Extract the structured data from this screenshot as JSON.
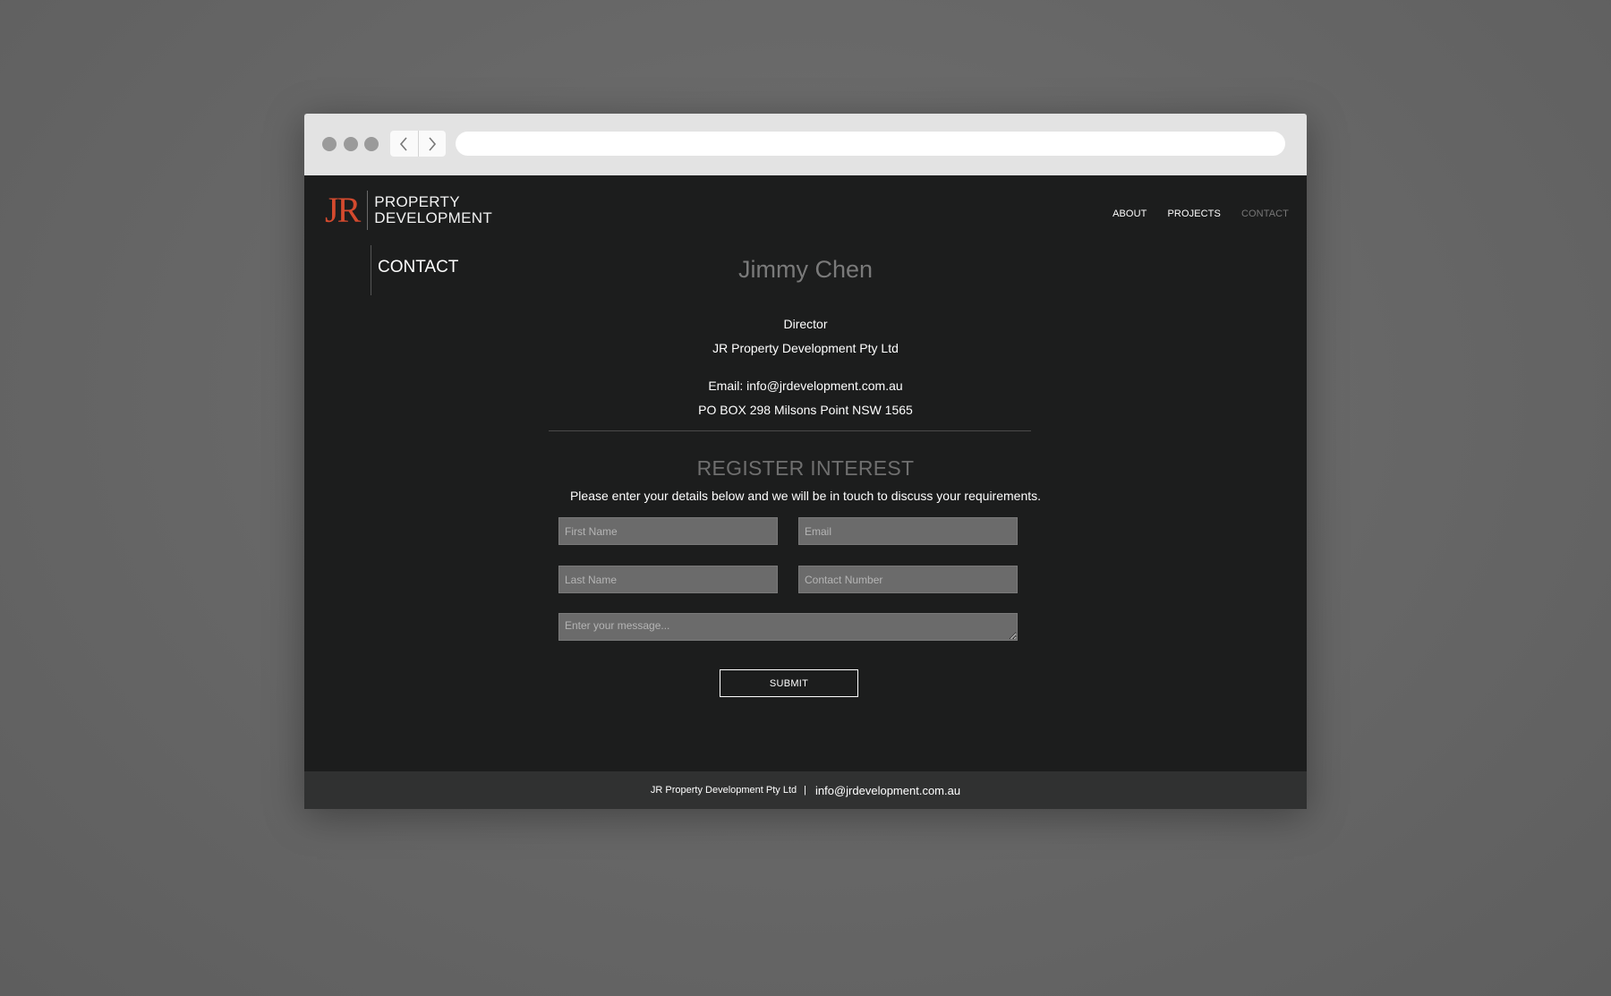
{
  "logo": {
    "mark": "JR",
    "line1": "PROPERTY",
    "line2": "DEVELOPMENT"
  },
  "nav": {
    "about": "ABOUT",
    "projects": "PROJECTS",
    "contact": "CONTACT"
  },
  "sidebar": {
    "title": "CONTACT"
  },
  "contact": {
    "name": "Jimmy Chen",
    "role": "Director",
    "company": "JR Property Development Pty Ltd",
    "email": "Email: info@jrdevelopment.com.au",
    "address": "PO BOX 298 Milsons Point NSW 1565"
  },
  "register": {
    "title": "REGISTER INTEREST",
    "intro": "Please enter your details below and we will be in touch to discuss your requirements.",
    "first_name_placeholder": "First Name",
    "email_placeholder": "Email",
    "last_name_placeholder": "Last Name",
    "contact_number_placeholder": "Contact Number",
    "message_placeholder": "Enter your message...",
    "submit_label": "SUBMIT"
  },
  "footer": {
    "company": "JR Property Development Pty Ltd",
    "separator": "|",
    "email": "info@jrdevelopment.com.au"
  },
  "colors": {
    "accent": "#d44a2e",
    "page_bg": "#1c1d1d",
    "footer_bg": "#303131",
    "field_bg": "#6b6b6b"
  }
}
